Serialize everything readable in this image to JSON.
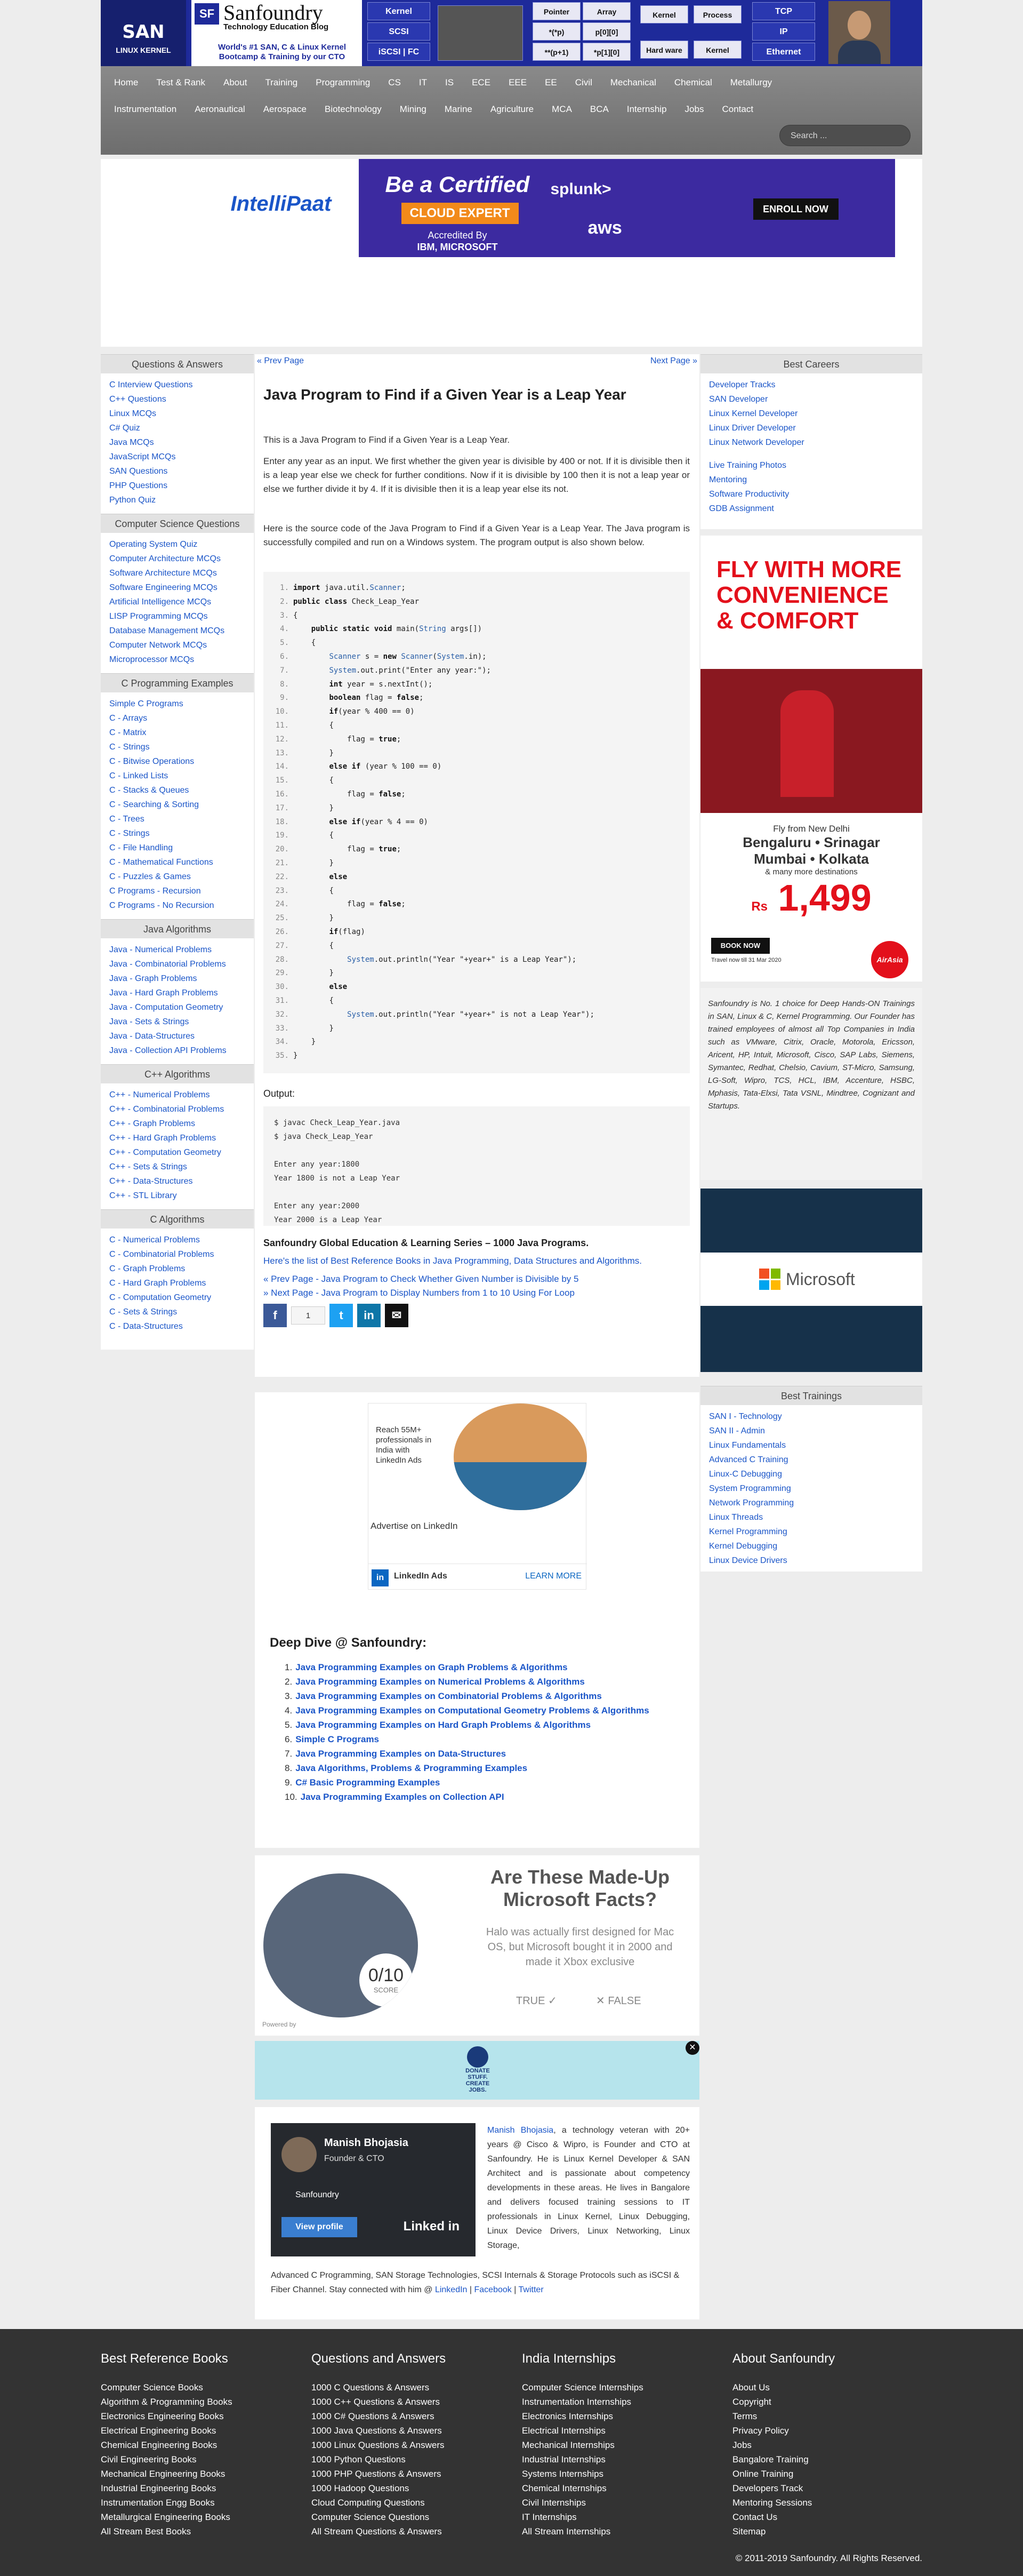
{
  "header": {
    "logo_san": "SAN",
    "logo_sub": "LINUX KERNEL",
    "brand_name": "Sanfoundry",
    "brand_box": "SF",
    "tagline": "Technology Education Blog",
    "sub1": "World's #1 SAN, C & Linux Kernel",
    "sub2": "Bootcamp & Training by our CTO",
    "tiles": [
      "Kernel",
      "SCSI",
      "iSCSI | FC",
      "Pointer",
      "Array",
      "*(*p)",
      "p[0][0]",
      "**(p+1)",
      "p[1][0]",
      "**(p+1)",
      "*p[1][0]",
      "Kernel",
      "Process",
      "Hard ware",
      "Kernel",
      "TCP",
      "IP",
      "Ethernet"
    ]
  },
  "nav": {
    "row1": [
      "Home",
      "Test & Rank",
      "About",
      "Training",
      "Programming",
      "CS",
      "IT",
      "IS",
      "ECE",
      "EEE",
      "EE",
      "Civil",
      "Mechanical",
      "Chemical",
      "Metallurgy"
    ],
    "row2": [
      "Instrumentation",
      "Aeronautical",
      "Aerospace",
      "Biotechnology",
      "Mining",
      "Marine",
      "Agriculture",
      "MCA",
      "BCA",
      "Internship",
      "Jobs",
      "Contact"
    ],
    "search_placeholder": "Search ..."
  },
  "top_ad": {
    "brand": "IntelliPaat",
    "headline": "Be a Certified",
    "badge": "CLOUD EXPERT",
    "accredited": "Accredited By",
    "accredited2": "IBM, MICROSOFT",
    "logos": [
      "splunk>",
      "aws"
    ],
    "cta": "ENROLL NOW"
  },
  "left": {
    "sections": [
      {
        "title": "Questions & Answers",
        "items": [
          "C Interview Questions",
          "C++ Questions",
          "Linux MCQs",
          "C# Quiz",
          "Java MCQs",
          "JavaScript MCQs",
          "SAN Questions",
          "PHP Questions",
          "Python Quiz"
        ]
      },
      {
        "title": "Computer Science Questions",
        "items": [
          "Operating System Quiz",
          "Computer Architecture MCQs",
          "Software Architecture MCQs",
          "Software Engineering MCQs",
          "Artificial Intelligence MCQs",
          "LISP Programming MCQs",
          "Database Management MCQs",
          "Computer Network MCQs",
          "Microprocessor MCQs"
        ]
      },
      {
        "title": "C Programming Examples",
        "items": [
          "Simple C Programs",
          "C - Arrays",
          "C - Matrix",
          "C - Strings",
          "C - Bitwise Operations",
          "C - Linked Lists",
          "C - Stacks & Queues",
          "C - Searching & Sorting",
          "C - Trees",
          "C - Strings",
          "C - File Handling",
          "C - Mathematical Functions",
          "C - Puzzles & Games",
          "C Programs - Recursion",
          "C Programs - No Recursion"
        ]
      },
      {
        "title": "Java Algorithms",
        "items": [
          "Java - Numerical Problems",
          "Java - Combinatorial Problems",
          "Java - Graph Problems",
          "Java - Hard Graph Problems",
          "Java - Computation Geometry",
          "Java - Sets & Strings",
          "Java - Data-Structures",
          "Java - Collection API Problems"
        ]
      },
      {
        "title": "C++ Algorithms",
        "items": [
          "C++ - Numerical Problems",
          "C++ - Combinatorial Problems",
          "C++ - Graph Problems",
          "C++ - Hard Graph Problems",
          "C++ - Computation Geometry",
          "C++ - Sets & Strings",
          "C++ - Data-Structures",
          "C++ - STL Library"
        ]
      },
      {
        "title": "C Algorithms",
        "items": [
          "C - Numerical Problems",
          "C - Combinatorial Problems",
          "C - Graph Problems",
          "C - Hard Graph Problems",
          "C - Computation Geometry",
          "C - Sets & Strings",
          "C - Data-Structures"
        ]
      }
    ]
  },
  "main": {
    "prev": "« Prev Page",
    "next": "Next Page »",
    "title": "Java Program to Find if a Given Year is a Leap Year",
    "p1": "This is a Java Program to Find if a Given Year is a Leap Year.",
    "p2": "Enter any year as an input. We first whether the given year is divisible by 400 or not. If it is divisible then it is a leap year else we check for further conditions. Now if it is divisible by 100 then it is not a leap year or else we further divide it by 4. If it is divisible then it is a leap year else its not.",
    "p3": "Here is the source code of the Java Program to Find if a Given Year is a Leap Year. The Java program is successfully compiled and run on a Windows system. The program output is also shown below.",
    "code": [
      "import java.util.Scanner;",
      "public class Check_Leap_Year",
      "{",
      "    public static void main(String args[])",
      "    {",
      "        Scanner s = new Scanner(System.in);",
      "        System.out.print(\"Enter any year:\");",
      "        int year = s.nextInt();",
      "        boolean flag = false;",
      "        if(year % 400 == 0)",
      "        {",
      "            flag = true;",
      "        }",
      "        else if (year % 100 == 0)",
      "        {",
      "            flag = false;",
      "        }",
      "        else if(year % 4 == 0)",
      "        {",
      "            flag = true;",
      "        }",
      "        else",
      "        {",
      "            flag = false;",
      "        }",
      "        if(flag)",
      "        {",
      "            System.out.println(\"Year \"+year+\" is a Leap Year\");",
      "        }",
      "        else",
      "        {",
      "            System.out.println(\"Year \"+year+\" is not a Leap Year\");",
      "        }",
      "    }",
      "}"
    ],
    "output_label": "Output:",
    "output": "$ javac Check_Leap_Year.java\n$ java Check_Leap_Year\n\nEnter any year:1800\nYear 1800 is not a Leap Year\n\nEnter any year:2000\nYear 2000 is a Leap Year",
    "series": "Sanfoundry Global Education & Learning Series – 1000 Java Programs.",
    "reflink": "Here's the list of Best Reference Books in Java Programming, Data Structures and Algorithms.",
    "prev_link": "« Prev Page - Java Program to Check Whether Given Number is Divisible by 5",
    "next_link": "» Next Page - Java Program to Display Numbers from 1 to 10 Using For Loop",
    "share_count": "1"
  },
  "linkedin_ad": {
    "line1": "Reach 55M+",
    "line2": "professionals in",
    "line3": "India with",
    "line4": "LinkedIn Ads",
    "advertise": "Advertise on LinkedIn",
    "brand": "LinkedIn Ads",
    "learn": "LEARN MORE"
  },
  "deep": {
    "title": "Deep Dive @ Sanfoundry:",
    "items": [
      "Java Programming Examples on Graph Problems & Algorithms",
      "Java Programming Examples on Numerical Problems & Algorithms",
      "Java Programming Examples on Combinatorial Problems & Algorithms",
      "Java Programming Examples on Computational Geometry Problems & Algorithms",
      "Java Programming Examples on Hard Graph Problems & Algorithms",
      "Simple C Programs",
      "Java Programming Examples on Data-Structures",
      "Java Algorithms, Problems & Programming Examples",
      "C# Basic Programming Examples",
      "Java Programming Examples on Collection API"
    ]
  },
  "quiz": {
    "title": "Are These Made-Up Microsoft Facts?",
    "text": "Halo was actually first designed for Mac OS, but Microsoft bought it in 2000 and made it Xbox exclusive",
    "score": "0/10",
    "score_label": "SCORE",
    "true": "TRUE",
    "false": "FALSE",
    "powered": "Powered by"
  },
  "goodwill": {
    "line1": "DONATE STUFF.",
    "line2": "CREATE JOBS."
  },
  "author": {
    "name": "Manish Bhojasia",
    "role": "Founder & CTO",
    "org": "Sanfoundry",
    "view": "View profile",
    "linkedin": "Linked in",
    "bio_name": "Manish Bhojasia",
    "bio": ", a technology veteran with 20+ years @ Cisco & Wipro, is Founder and CTO at Sanfoundry. He is Linux Kernel Developer & SAN Architect and is passionate about competency developments in these areas. He lives in Bangalore and delivers focused training sessions to IT professionals in Linux Kernel, Linux Debugging, Linux Device Drivers, Linux Networking, Linux Storage,",
    "bio2": "Advanced C Programming, SAN Storage Technologies, SCSI Internals & Storage Protocols such as iSCSI & Fiber Channel. Stay connected with him @",
    "bio_links": [
      "LinkedIn",
      "Facebook",
      "Twitter"
    ]
  },
  "right": {
    "careers_title": "Best Careers",
    "careers": [
      "Developer Tracks",
      "SAN Developer",
      "Linux Kernel Developer",
      "Linux Driver Developer",
      "Linux Network Developer"
    ],
    "careers2": [
      "Live Training Photos",
      "Mentoring",
      "Software Productivity",
      "GDB Assignment"
    ],
    "airasia": {
      "h1": "FLY WITH MORE",
      "h2": "CONVENIENCE",
      "h3": "& COMFORT",
      "from": "Fly from New Delhi",
      "to1": "Bengaluru • Srinagar",
      "to2": "Mumbai • Kolkata",
      "more": "& many more destinations",
      "price": "1,499",
      "currency": "Rs",
      "book": "BOOK NOW",
      "travel": "Travel now till 31 Mar 2020",
      "brand": "AirAsia"
    },
    "desc": "Sanfoundry is No. 1 choice for Deep Hands-ON Trainings in SAN, Linux & C, Kernel Programming. Our Founder has trained employees of almost all Top Companies in India such as VMware, Citrix, Oracle, Motorola, Ericsson, Aricent, HP, Intuit, Microsoft, Cisco, SAP Labs, Siemens, Symantec, Redhat, Chelsio, Cavium, ST-Micro, Samsung, LG-Soft, Wipro, TCS, HCL, IBM, Accenture, HSBC, Mphasis, Tata-Elxsi, Tata VSNL, Mindtree, Cognizant and Startups.",
    "microsoft": "Microsoft",
    "trainings_title": "Best Trainings",
    "trainings": [
      "SAN I - Technology",
      "SAN II - Admin",
      "Linux Fundamentals",
      "Advanced C Training",
      "Linux-C Debugging",
      "System Programming",
      "Network Programming",
      "Linux Threads",
      "Kernel Programming",
      "Kernel Debugging",
      "Linux Device Drivers"
    ]
  },
  "footer": {
    "cols": [
      {
        "title": "Best Reference Books",
        "items": [
          "Computer Science Books",
          "Algorithm & Programming Books",
          "Electronics Engineering Books",
          "Electrical Engineering Books",
          "Chemical Engineering Books",
          "Civil Engineering Books",
          "Mechanical Engineering Books",
          "Industrial Engineering Books",
          "Instrumentation Engg Books",
          "Metallurgical Engineering Books",
          "All Stream Best Books"
        ]
      },
      {
        "title": "Questions and Answers",
        "items": [
          "1000 C Questions & Answers",
          "1000 C++ Questions & Answers",
          "1000 C# Questions & Answers",
          "1000 Java Questions & Answers",
          "1000 Linux Questions & Answers",
          "1000 Python Questions",
          "1000 PHP Questions & Answers",
          "1000 Hadoop Questions",
          "Cloud Computing Questions",
          "Computer Science Questions",
          "All Stream Questions & Answers"
        ]
      },
      {
        "title": "India Internships",
        "items": [
          "Computer Science Internships",
          "Instrumentation Internships",
          "Electronics Internships",
          "Electrical Internships",
          "Mechanical Internships",
          "Industrial Internships",
          "Systems Internships",
          "Chemical Internships",
          "Civil Internships",
          "IT Internships",
          "All Stream Internships"
        ]
      },
      {
        "title": "About Sanfoundry",
        "items": [
          "About Us",
          "Copyright",
          "Terms",
          "Privacy Policy",
          "Jobs",
          "Bangalore Training",
          "Online Training",
          "Developers Track",
          "Mentoring Sessions",
          "Contact Us",
          "Sitemap"
        ]
      }
    ],
    "copyright": "© 2011-2019 Sanfoundry. All Rights Reserved."
  }
}
